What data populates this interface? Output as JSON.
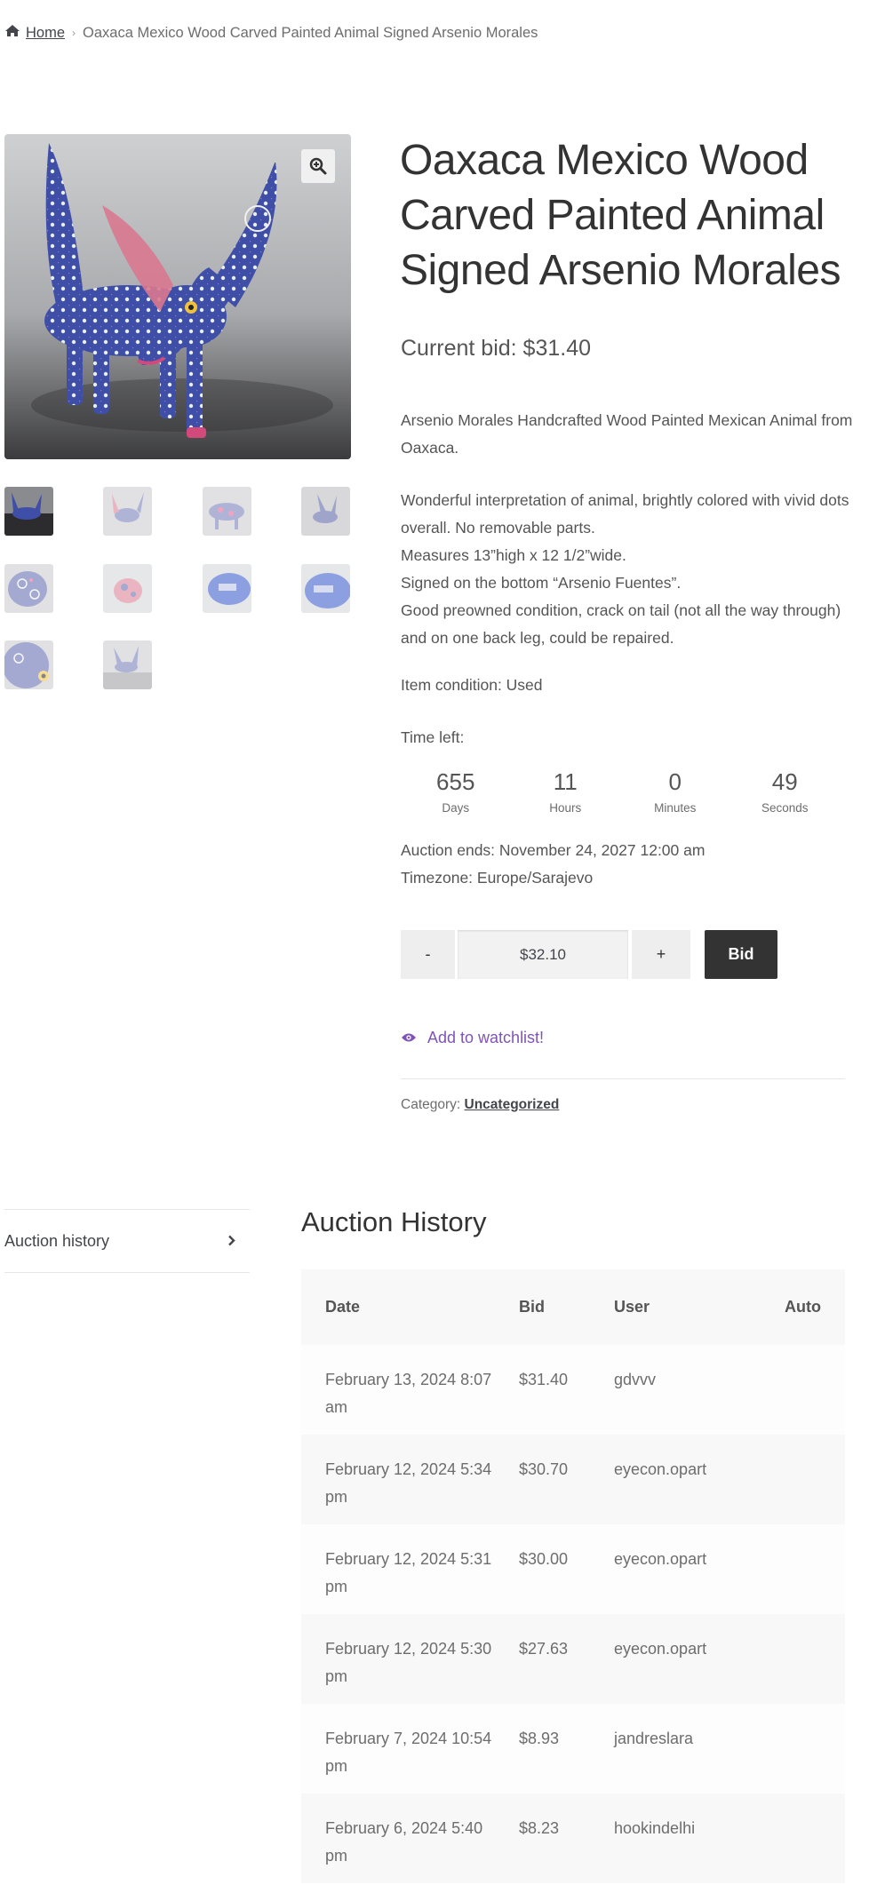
{
  "breadcrumb": {
    "home": "Home",
    "current": "Oaxaca Mexico Wood Carved Painted Animal Signed Arsenio Morales"
  },
  "product": {
    "title": "Oaxaca Mexico Wood Carved Painted Animal Signed Arsenio Morales",
    "current_bid": "Current bid: $31.40",
    "description": [
      "Arsenio Morales Handcrafted Wood Painted Mexican Animal from Oaxaca.",
      "Wonderful interpretation of animal, brightly colored with vivid dots overall. No removable parts.",
      "Measures 13”high x 12 1/2”wide.",
      "Signed on the bottom “Arsenio Fuentes”.",
      "Good preowned condition, crack on tail (not all the way through) and on one back leg, could be repaired."
    ],
    "condition": "Item condition: Used",
    "time_left_label": "Time left:",
    "countdown": [
      {
        "value": "655",
        "label": "Days"
      },
      {
        "value": "11",
        "label": "Hours"
      },
      {
        "value": "0",
        "label": "Minutes"
      },
      {
        "value": "49",
        "label": "Seconds"
      }
    ],
    "auction_ends": "Auction ends: November 24, 2027 12:00 am",
    "timezone": "Timezone: Europe/Sarajevo",
    "bid_form": {
      "minus": "-",
      "amount": "$32.10",
      "plus": "+",
      "submit": "Bid"
    },
    "watchlist": "Add to watchlist!",
    "category_label": "Category: ",
    "category": "Uncategorized"
  },
  "gallery": {
    "thumbnail_count": 10
  },
  "tabs": {
    "auction_history": "Auction history"
  },
  "history": {
    "title": "Auction History",
    "columns": [
      "Date",
      "Bid",
      "User",
      "Auto"
    ],
    "rows": [
      {
        "date_1": "February 13, 2024 8:07",
        "date_2": "am",
        "bid": "$31.40",
        "user": "gdvvv",
        "auto": ""
      },
      {
        "date_1": "February 12, 2024 5:34",
        "date_2": "pm",
        "bid": "$30.70",
        "user": "eyecon.opart",
        "auto": ""
      },
      {
        "date_1": "February 12, 2024 5:31",
        "date_2": "pm",
        "bid": "$30.00",
        "user": "eyecon.opart",
        "auto": ""
      },
      {
        "date_1": "February 12, 2024 5:30",
        "date_2": "pm",
        "bid": "$27.63",
        "user": "eyecon.opart",
        "auto": ""
      },
      {
        "date_1": "February 7, 2024 10:54",
        "date_2": "pm",
        "bid": "$8.93",
        "user": "jandreslara",
        "auto": ""
      },
      {
        "date_1": "February 6, 2024 5:40",
        "date_2": "pm",
        "bid": "$8.23",
        "user": "hookindelhi",
        "auto": ""
      }
    ]
  },
  "colors": {
    "accent": "#7f54b3",
    "button_dark": "#333333",
    "text": "#43454b"
  },
  "icons": {
    "home": "home-icon",
    "breadcrumb_separator": "chevron-right-icon",
    "zoom": "magnifier-plus-icon",
    "watchlist": "eye-icon",
    "tab_arrow": "chevron-right-icon"
  }
}
